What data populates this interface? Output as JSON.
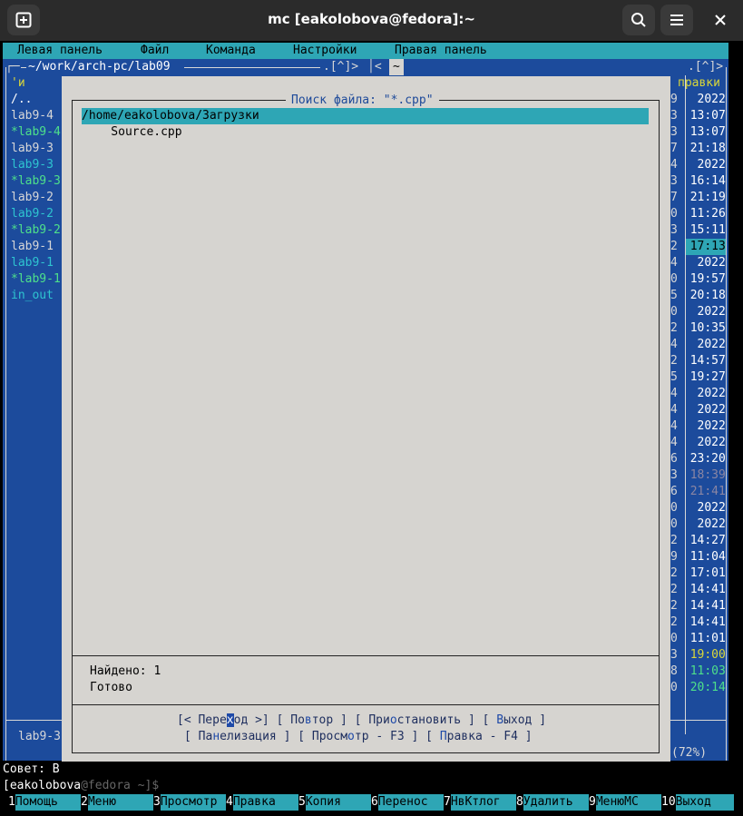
{
  "window": {
    "title": "mc [eakolobova@fedora]:~"
  },
  "menu": [
    "Левая панель",
    "Файл",
    "Команда",
    "Настройки",
    "Правая панель"
  ],
  "left_panel": {
    "path": "~/work/arch-pc/lab09",
    "hist": ".[^]>",
    "col_header": "'и",
    "rows": [
      {
        "name": "/..",
        "cls": "c-white"
      },
      {
        "name": "lab9-4",
        "cls": "pline"
      },
      {
        "name": "*lab9-4",
        "cls": "c-green"
      },
      {
        "name": "lab9-3",
        "cls": "pline"
      },
      {
        "name": "lab9-3",
        "cls": "c-cyan"
      },
      {
        "name": "*lab9-3",
        "cls": "c-green"
      },
      {
        "name": "lab9-2",
        "cls": "pline"
      },
      {
        "name": "lab9-2",
        "cls": "c-cyan"
      },
      {
        "name": "*lab9-2",
        "cls": "c-green"
      },
      {
        "name": "lab9-1",
        "cls": "pline"
      },
      {
        "name": "lab9-1",
        "cls": "c-cyan"
      },
      {
        "name": "*lab9-1",
        "cls": "c-green"
      },
      {
        "name": "in_out",
        "cls": "c-cyan"
      }
    ],
    "mini": "lab9-3",
    "hint_prefix": "Совет: В"
  },
  "right_panel": {
    "path": "~",
    "hist": ".[^]>",
    "col_header": "правки",
    "times": [
      {
        "d": "9",
        "t": "2022",
        "cls": "c-white"
      },
      {
        "d": "3",
        "t": "13:07",
        "cls": "c-white"
      },
      {
        "d": "3",
        "t": "13:07",
        "cls": "c-white"
      },
      {
        "d": "7",
        "t": "21:18",
        "cls": "c-white"
      },
      {
        "d": "4",
        "t": "2022",
        "cls": "c-white"
      },
      {
        "d": "3",
        "t": "16:14",
        "cls": "c-white"
      },
      {
        "d": "7",
        "t": "21:19",
        "cls": "c-white"
      },
      {
        "d": "0",
        "t": "11:26",
        "cls": "c-white"
      },
      {
        "d": "3",
        "t": "15:11",
        "cls": "c-white"
      },
      {
        "d": "2",
        "t": "17:13",
        "cls": "c-sel"
      },
      {
        "d": "4",
        "t": "2022",
        "cls": "c-white"
      },
      {
        "d": "0",
        "t": "19:57",
        "cls": "c-white"
      },
      {
        "d": "5",
        "t": "20:18",
        "cls": "c-white"
      },
      {
        "d": "0",
        "t": "2022",
        "cls": "c-white"
      },
      {
        "d": "2",
        "t": "10:35",
        "cls": "c-white"
      },
      {
        "d": "4",
        "t": "2022",
        "cls": "c-white"
      },
      {
        "d": "2",
        "t": "14:57",
        "cls": "c-white"
      },
      {
        "d": "5",
        "t": "19:27",
        "cls": "c-white"
      },
      {
        "d": "4",
        "t": "2022",
        "cls": "c-white"
      },
      {
        "d": "4",
        "t": "2022",
        "cls": "c-white"
      },
      {
        "d": "4",
        "t": "2022",
        "cls": "c-white"
      },
      {
        "d": "4",
        "t": "2022",
        "cls": "c-white"
      },
      {
        "d": "6",
        "t": "23:20",
        "cls": "c-white"
      },
      {
        "d": "3",
        "t": "18:39",
        "cls": "c-dim"
      },
      {
        "d": "6",
        "t": "21:41",
        "cls": "c-dim"
      },
      {
        "d": "0",
        "t": "2022",
        "cls": "c-white"
      },
      {
        "d": "0",
        "t": "2022",
        "cls": "c-white"
      },
      {
        "d": "2",
        "t": "14:27",
        "cls": "c-white"
      },
      {
        "d": "9",
        "t": "11:04",
        "cls": "c-white"
      },
      {
        "d": "2",
        "t": "17:01",
        "cls": "c-white"
      },
      {
        "d": "2",
        "t": "14:41",
        "cls": "c-white"
      },
      {
        "d": "2",
        "t": "14:41",
        "cls": "c-white"
      },
      {
        "d": "2",
        "t": "14:41",
        "cls": "c-white"
      },
      {
        "d": "0",
        "t": "11:01",
        "cls": "c-white"
      },
      {
        "d": "3",
        "t": "19:00",
        "cls": "c-yellow"
      },
      {
        "d": "8",
        "t": "11:03",
        "cls": "c-green"
      },
      {
        "d": "0",
        "t": "20:14",
        "cls": "c-green"
      }
    ],
    "footer": "(72%)"
  },
  "dialog": {
    "title": "Поиск файла: \"*.cpp\"",
    "results": [
      {
        "text": "/home/eakolobova/Загрузки",
        "selected": true
      },
      {
        "text": "    Source.cpp",
        "selected": false
      }
    ],
    "found": "Найдено: 1",
    "status": "Готово",
    "buttons_row1": [
      {
        "pre": "[< Пере",
        "hot": "х",
        "post": "од >]",
        "hot_selected": true
      },
      {
        "pre": "[ По",
        "hot": "в",
        "post": "тор ]",
        "hot_selected": false
      },
      {
        "pre": "[ При",
        "hot": "о",
        "post": "становить ]",
        "hot_selected": false
      },
      {
        "pre": "[ ",
        "hot": "В",
        "post": "ыход ]",
        "hot_selected": false
      }
    ],
    "buttons_row2": [
      {
        "pre": "[ Па",
        "hot": "н",
        "post": "елизация ]",
        "hot_selected": false
      },
      {
        "pre": "[ Просм",
        "hot": "о",
        "post": "тр - F3 ]",
        "hot_selected": false
      },
      {
        "pre": "[ ",
        "hot": "П",
        "post": "равка - F4 ]",
        "hot_selected": false
      }
    ]
  },
  "cmdline": {
    "user": "[eakolobova",
    "at": "@fedora",
    "path": " ~]$"
  },
  "fkeys": [
    {
      "n": "1",
      "l": "Помощь"
    },
    {
      "n": "2",
      "l": "Меню"
    },
    {
      "n": "3",
      "l": "Просмотр"
    },
    {
      "n": "4",
      "l": "Правка"
    },
    {
      "n": "5",
      "l": "Копия"
    },
    {
      "n": "6",
      "l": "Перенос"
    },
    {
      "n": "7",
      "l": "НвКтлог"
    },
    {
      "n": "8",
      "l": "Удалить"
    },
    {
      "n": "9",
      "l": "МенюMC"
    },
    {
      "n": "10",
      "l": "Выход"
    }
  ]
}
